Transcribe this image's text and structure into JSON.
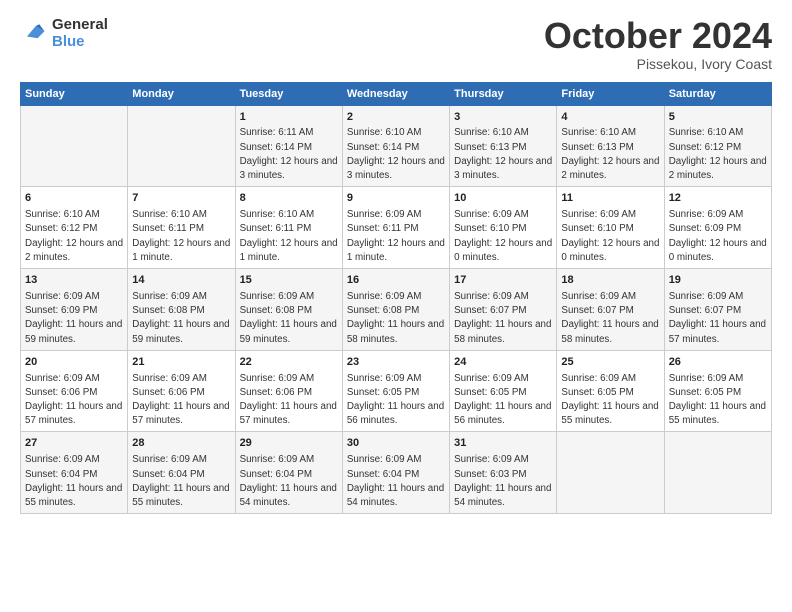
{
  "logo": {
    "line1": "General",
    "line2": "Blue"
  },
  "title": "October 2024",
  "subtitle": "Pissekou, Ivory Coast",
  "headers": [
    "Sunday",
    "Monday",
    "Tuesday",
    "Wednesday",
    "Thursday",
    "Friday",
    "Saturday"
  ],
  "weeks": [
    [
      {
        "day": "",
        "detail": ""
      },
      {
        "day": "",
        "detail": ""
      },
      {
        "day": "1",
        "detail": "Sunrise: 6:11 AM\nSunset: 6:14 PM\nDaylight: 12 hours and 3 minutes."
      },
      {
        "day": "2",
        "detail": "Sunrise: 6:10 AM\nSunset: 6:14 PM\nDaylight: 12 hours and 3 minutes."
      },
      {
        "day": "3",
        "detail": "Sunrise: 6:10 AM\nSunset: 6:13 PM\nDaylight: 12 hours and 3 minutes."
      },
      {
        "day": "4",
        "detail": "Sunrise: 6:10 AM\nSunset: 6:13 PM\nDaylight: 12 hours and 2 minutes."
      },
      {
        "day": "5",
        "detail": "Sunrise: 6:10 AM\nSunset: 6:12 PM\nDaylight: 12 hours and 2 minutes."
      }
    ],
    [
      {
        "day": "6",
        "detail": "Sunrise: 6:10 AM\nSunset: 6:12 PM\nDaylight: 12 hours and 2 minutes."
      },
      {
        "day": "7",
        "detail": "Sunrise: 6:10 AM\nSunset: 6:11 PM\nDaylight: 12 hours and 1 minute."
      },
      {
        "day": "8",
        "detail": "Sunrise: 6:10 AM\nSunset: 6:11 PM\nDaylight: 12 hours and 1 minute."
      },
      {
        "day": "9",
        "detail": "Sunrise: 6:09 AM\nSunset: 6:11 PM\nDaylight: 12 hours and 1 minute."
      },
      {
        "day": "10",
        "detail": "Sunrise: 6:09 AM\nSunset: 6:10 PM\nDaylight: 12 hours and 0 minutes."
      },
      {
        "day": "11",
        "detail": "Sunrise: 6:09 AM\nSunset: 6:10 PM\nDaylight: 12 hours and 0 minutes."
      },
      {
        "day": "12",
        "detail": "Sunrise: 6:09 AM\nSunset: 6:09 PM\nDaylight: 12 hours and 0 minutes."
      }
    ],
    [
      {
        "day": "13",
        "detail": "Sunrise: 6:09 AM\nSunset: 6:09 PM\nDaylight: 11 hours and 59 minutes."
      },
      {
        "day": "14",
        "detail": "Sunrise: 6:09 AM\nSunset: 6:08 PM\nDaylight: 11 hours and 59 minutes."
      },
      {
        "day": "15",
        "detail": "Sunrise: 6:09 AM\nSunset: 6:08 PM\nDaylight: 11 hours and 59 minutes."
      },
      {
        "day": "16",
        "detail": "Sunrise: 6:09 AM\nSunset: 6:08 PM\nDaylight: 11 hours and 58 minutes."
      },
      {
        "day": "17",
        "detail": "Sunrise: 6:09 AM\nSunset: 6:07 PM\nDaylight: 11 hours and 58 minutes."
      },
      {
        "day": "18",
        "detail": "Sunrise: 6:09 AM\nSunset: 6:07 PM\nDaylight: 11 hours and 58 minutes."
      },
      {
        "day": "19",
        "detail": "Sunrise: 6:09 AM\nSunset: 6:07 PM\nDaylight: 11 hours and 57 minutes."
      }
    ],
    [
      {
        "day": "20",
        "detail": "Sunrise: 6:09 AM\nSunset: 6:06 PM\nDaylight: 11 hours and 57 minutes."
      },
      {
        "day": "21",
        "detail": "Sunrise: 6:09 AM\nSunset: 6:06 PM\nDaylight: 11 hours and 57 minutes."
      },
      {
        "day": "22",
        "detail": "Sunrise: 6:09 AM\nSunset: 6:06 PM\nDaylight: 11 hours and 57 minutes."
      },
      {
        "day": "23",
        "detail": "Sunrise: 6:09 AM\nSunset: 6:05 PM\nDaylight: 11 hours and 56 minutes."
      },
      {
        "day": "24",
        "detail": "Sunrise: 6:09 AM\nSunset: 6:05 PM\nDaylight: 11 hours and 56 minutes."
      },
      {
        "day": "25",
        "detail": "Sunrise: 6:09 AM\nSunset: 6:05 PM\nDaylight: 11 hours and 55 minutes."
      },
      {
        "day": "26",
        "detail": "Sunrise: 6:09 AM\nSunset: 6:05 PM\nDaylight: 11 hours and 55 minutes."
      }
    ],
    [
      {
        "day": "27",
        "detail": "Sunrise: 6:09 AM\nSunset: 6:04 PM\nDaylight: 11 hours and 55 minutes."
      },
      {
        "day": "28",
        "detail": "Sunrise: 6:09 AM\nSunset: 6:04 PM\nDaylight: 11 hours and 55 minutes."
      },
      {
        "day": "29",
        "detail": "Sunrise: 6:09 AM\nSunset: 6:04 PM\nDaylight: 11 hours and 54 minutes."
      },
      {
        "day": "30",
        "detail": "Sunrise: 6:09 AM\nSunset: 6:04 PM\nDaylight: 11 hours and 54 minutes."
      },
      {
        "day": "31",
        "detail": "Sunrise: 6:09 AM\nSunset: 6:03 PM\nDaylight: 11 hours and 54 minutes."
      },
      {
        "day": "",
        "detail": ""
      },
      {
        "day": "",
        "detail": ""
      }
    ]
  ]
}
